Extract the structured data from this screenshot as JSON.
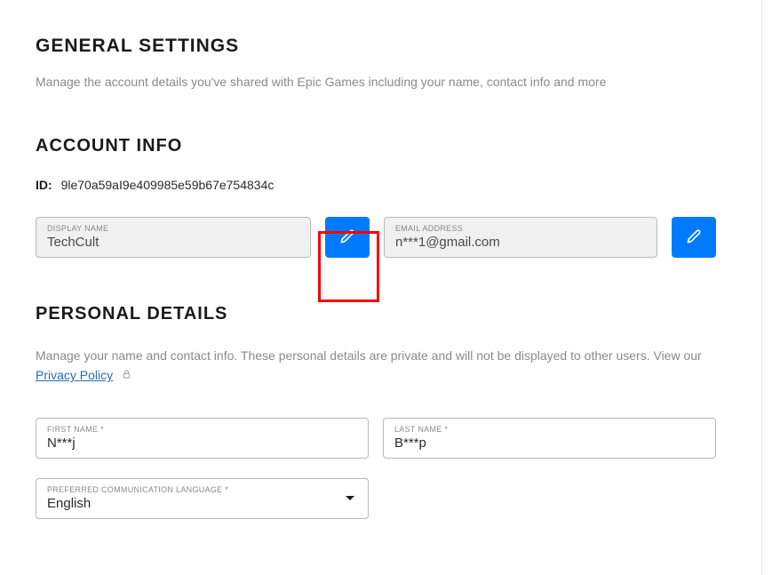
{
  "general": {
    "title": "GENERAL SETTINGS",
    "subtitle": "Manage the account details you've shared with Epic Games including your name, contact info and more"
  },
  "account": {
    "title": "ACCOUNT INFO",
    "id_label": "ID:",
    "id_value": "9le70a59aI9e409985e59b67e754834c",
    "display_name": {
      "label": "DISPLAY NAME",
      "value": "TechCult"
    },
    "email": {
      "label": "EMAIL ADDRESS",
      "value": "n***1@gmail.com"
    }
  },
  "personal": {
    "title": "PERSONAL DETAILS",
    "desc_prefix": "Manage your name and contact info. These personal details are private and will not be displayed to other users. View our ",
    "privacy_link": "Privacy Policy",
    "first_name": {
      "label": "FIRST NAME *",
      "value": "N***j"
    },
    "last_name": {
      "label": "LAST NAME *",
      "value": "B***p"
    },
    "language": {
      "label": "PREFERRED COMMUNICATION LANGUAGE *",
      "value": "English"
    }
  }
}
